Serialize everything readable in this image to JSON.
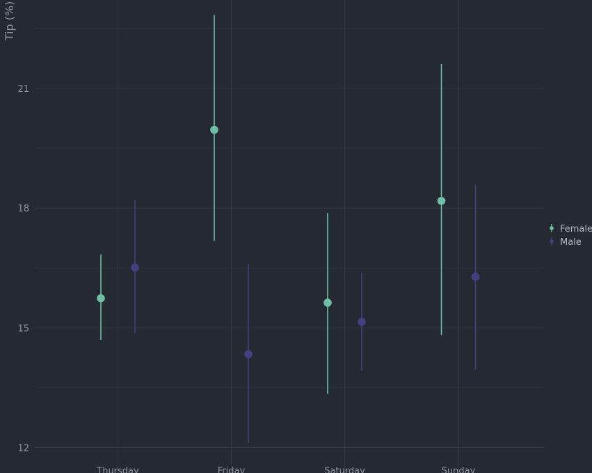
{
  "chart_data": {
    "type": "scatter",
    "subtype": "point-range",
    "title": "",
    "xlabel": "",
    "ylabel": "Tip (%)",
    "categories": [
      "Thursday",
      "Friday",
      "Saturday",
      "Sunday"
    ],
    "ylim": [
      11.8,
      23.3
    ],
    "yticks": [
      12,
      15,
      18,
      21
    ],
    "grid": true,
    "legend_position": "right",
    "background": "#252932",
    "grid_color": "#343944",
    "series": [
      {
        "name": "Female",
        "color": "#6fbfa6",
        "values": [
          15.74,
          19.96,
          15.63,
          18.18
        ],
        "lower": [
          14.69,
          17.18,
          13.35,
          14.82
        ],
        "upper": [
          16.84,
          22.83,
          17.88,
          21.61
        ]
      },
      {
        "name": "Male",
        "color": "#433f80",
        "values": [
          16.51,
          14.34,
          15.15,
          16.28
        ],
        "lower": [
          14.86,
          12.12,
          13.93,
          13.95
        ],
        "upper": [
          18.2,
          16.61,
          16.38,
          18.57
        ]
      }
    ]
  }
}
